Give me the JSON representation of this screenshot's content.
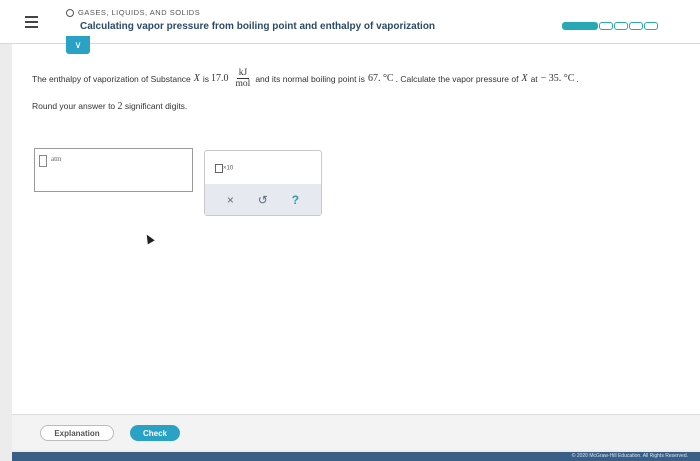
{
  "header": {
    "topic": "GASES, LIQUIDS, AND SOLIDS",
    "title": "Calculating vapor pressure from boiling point and enthalpy of vaporization"
  },
  "progress": {
    "filled_segments": 1,
    "total_segments": 5
  },
  "question": {
    "part1": "The enthalpy of vaporization of Substance",
    "var": "X",
    "part2": "is",
    "enthalpy_value": "17.0",
    "unit_numerator": "kJ",
    "unit_denominator": "mol",
    "part3": "and its normal boiling point is",
    "boiling_point": "67. °C",
    "part4": ". Calculate the vapor pressure of",
    "var2": "X",
    "part5": "at",
    "temperature": "− 35. °C",
    "part6": "."
  },
  "instruction": {
    "part1": "Round your answer to",
    "digits": "2",
    "part2": "significant digits."
  },
  "answer": {
    "value": "",
    "unit": "atm"
  },
  "tools": {
    "sci_label": "×10",
    "clear": "×",
    "undo": "↺",
    "help": "?"
  },
  "footer": {
    "explanation_label": "Explanation",
    "check_label": "Check",
    "copyright": "© 2020 McGraw-Hill Education. All Rights Reserved."
  },
  "colors": {
    "accent": "#2aa2c6",
    "progress": "#28a8b4",
    "title": "#2b4a6a"
  }
}
